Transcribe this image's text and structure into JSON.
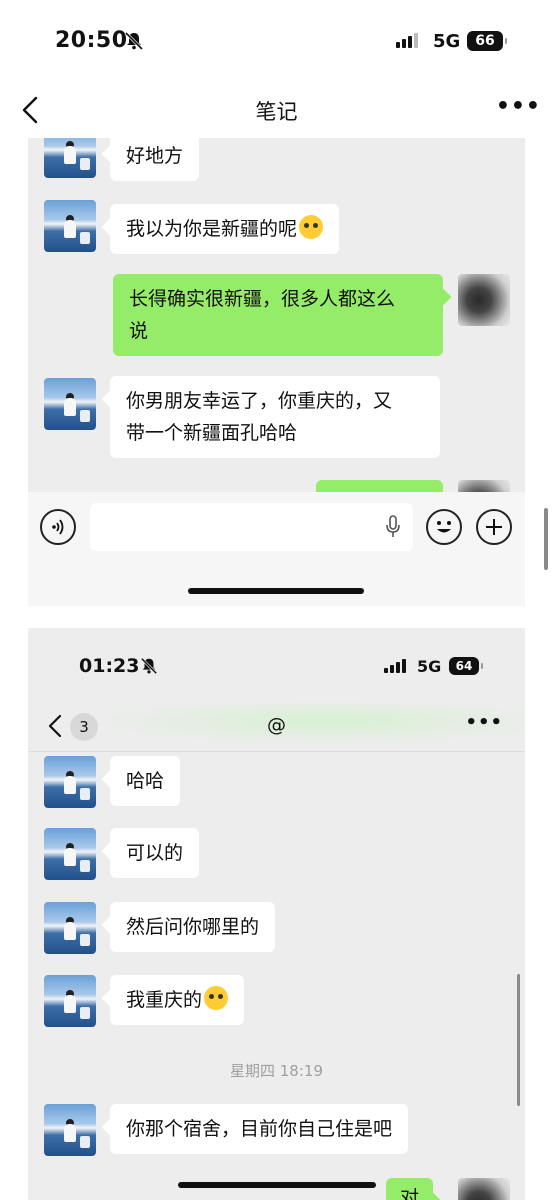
{
  "status_bar": {
    "time": "20:50",
    "network": "5G",
    "battery": "66"
  },
  "nav": {
    "title": "笔记"
  },
  "panel1": {
    "messages": [
      {
        "side": "left",
        "text": "好地方"
      },
      {
        "side": "left",
        "text": "我以为你是新疆的呢",
        "emoji": "emoji-face-icon"
      },
      {
        "side": "right",
        "line1": "长得确实很新疆，很多人都这么",
        "line2": "说"
      },
      {
        "side": "left",
        "line1": "你男朋友幸运了，你重庆的，又",
        "line2": "带一个新疆面孔哈哈"
      }
    ],
    "input": {
      "placeholder": ""
    }
  },
  "panel2": {
    "status": {
      "time": "01:23",
      "network": "5G",
      "battery": "64"
    },
    "nav": {
      "back_count": "3",
      "title": "@"
    },
    "messages": [
      {
        "side": "left",
        "text": "哈哈"
      },
      {
        "side": "left",
        "text": "可以的"
      },
      {
        "side": "left",
        "text": "然后问你哪里的"
      },
      {
        "side": "left",
        "text": "我重庆的",
        "emoji": "emoji-laugh-cry-icon"
      },
      {
        "side": "left",
        "text": "你那个宿舍，目前你自己住是吧"
      },
      {
        "side": "right",
        "text": "对"
      }
    ],
    "timestamp": "星期四 18:19"
  },
  "colors": {
    "chat_bg": "#ededed",
    "bubble_green": "#95ec69",
    "bubble_white": "#ffffff"
  }
}
